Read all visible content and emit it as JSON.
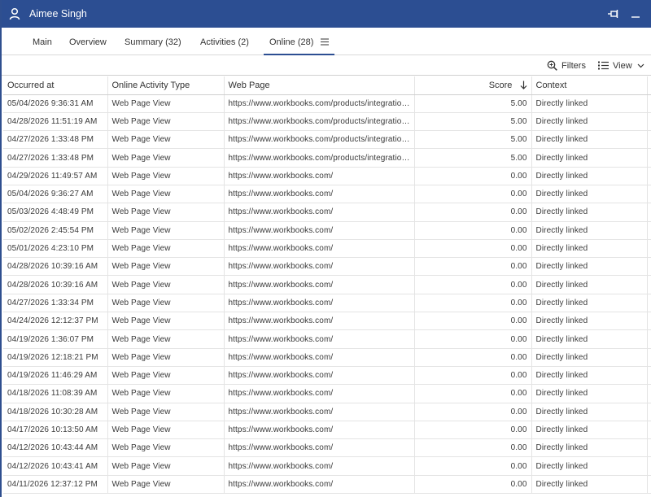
{
  "window": {
    "title": "Aimee Singh"
  },
  "tabs": [
    {
      "label": "Main",
      "active": false
    },
    {
      "label": "Overview",
      "active": false
    },
    {
      "label": "Summary (32)",
      "active": false
    },
    {
      "label": "Activities (2)",
      "active": false
    },
    {
      "label": "Online (28)",
      "active": true
    }
  ],
  "toolbar": {
    "filters_label": "Filters",
    "view_label": "View"
  },
  "table": {
    "columns": [
      "Occurred at",
      "Online Activity Type",
      "Web Page",
      "Score",
      "Context"
    ],
    "rows": [
      [
        "05/04/2026 9:36:31 AM",
        "Web Page View",
        "https://www.workbooks.com/products/integrations/",
        "5.00",
        "Directly linked"
      ],
      [
        "04/28/2026 11:51:19 AM",
        "Web Page View",
        "https://www.workbooks.com/products/integrations/",
        "5.00",
        "Directly linked"
      ],
      [
        "04/27/2026 1:33:48 PM",
        "Web Page View",
        "https://www.workbooks.com/products/integrations/",
        "5.00",
        "Directly linked"
      ],
      [
        "04/27/2026 1:33:48 PM",
        "Web Page View",
        "https://www.workbooks.com/products/integrations/",
        "5.00",
        "Directly linked"
      ],
      [
        "04/29/2026 11:49:57 AM",
        "Web Page View",
        "https://www.workbooks.com/",
        "0.00",
        "Directly linked"
      ],
      [
        "05/04/2026 9:36:27 AM",
        "Web Page View",
        "https://www.workbooks.com/",
        "0.00",
        "Directly linked"
      ],
      [
        "05/03/2026 4:48:49 PM",
        "Web Page View",
        "https://www.workbooks.com/",
        "0.00",
        "Directly linked"
      ],
      [
        "05/02/2026 2:45:54 PM",
        "Web Page View",
        "https://www.workbooks.com/",
        "0.00",
        "Directly linked"
      ],
      [
        "05/01/2026 4:23:10 PM",
        "Web Page View",
        "https://www.workbooks.com/",
        "0.00",
        "Directly linked"
      ],
      [
        "04/28/2026 10:39:16 AM",
        "Web Page View",
        "https://www.workbooks.com/",
        "0.00",
        "Directly linked"
      ],
      [
        "04/28/2026 10:39:16 AM",
        "Web Page View",
        "https://www.workbooks.com/",
        "0.00",
        "Directly linked"
      ],
      [
        "04/27/2026 1:33:34 PM",
        "Web Page View",
        "https://www.workbooks.com/",
        "0.00",
        "Directly linked"
      ],
      [
        "04/24/2026 12:12:37 PM",
        "Web Page View",
        "https://www.workbooks.com/",
        "0.00",
        "Directly linked"
      ],
      [
        "04/19/2026 1:36:07 PM",
        "Web Page View",
        "https://www.workbooks.com/",
        "0.00",
        "Directly linked"
      ],
      [
        "04/19/2026 12:18:21 PM",
        "Web Page View",
        "https://www.workbooks.com/",
        "0.00",
        "Directly linked"
      ],
      [
        "04/19/2026 11:46:29 AM",
        "Web Page View",
        "https://www.workbooks.com/",
        "0.00",
        "Directly linked"
      ],
      [
        "04/18/2026 11:08:39 AM",
        "Web Page View",
        "https://www.workbooks.com/",
        "0.00",
        "Directly linked"
      ],
      [
        "04/18/2026 10:30:28 AM",
        "Web Page View",
        "https://www.workbooks.com/",
        "0.00",
        "Directly linked"
      ],
      [
        "04/17/2026 10:13:50 AM",
        "Web Page View",
        "https://www.workbooks.com/",
        "0.00",
        "Directly linked"
      ],
      [
        "04/12/2026 10:43:44 AM",
        "Web Page View",
        "https://www.workbooks.com/",
        "0.00",
        "Directly linked"
      ],
      [
        "04/12/2026 10:43:41 AM",
        "Web Page View",
        "https://www.workbooks.com/",
        "0.00",
        "Directly linked"
      ],
      [
        "04/11/2026 12:37:12 PM",
        "Web Page View",
        "https://www.workbooks.com/",
        "0.00",
        "Directly linked"
      ]
    ]
  },
  "icons": {
    "title": "user-icon",
    "pin": "pin-icon",
    "minimize": "minimize-icon",
    "tab_menu": "menu-icon",
    "filters": "search-filter-icon",
    "view": "list-view-icon",
    "view_dropdown": "chevron-down-icon",
    "sort": "arrow-down-icon"
  },
  "colors": {
    "titlebar": "#2c4e92",
    "active_tab_underline": "#2c4e92"
  }
}
